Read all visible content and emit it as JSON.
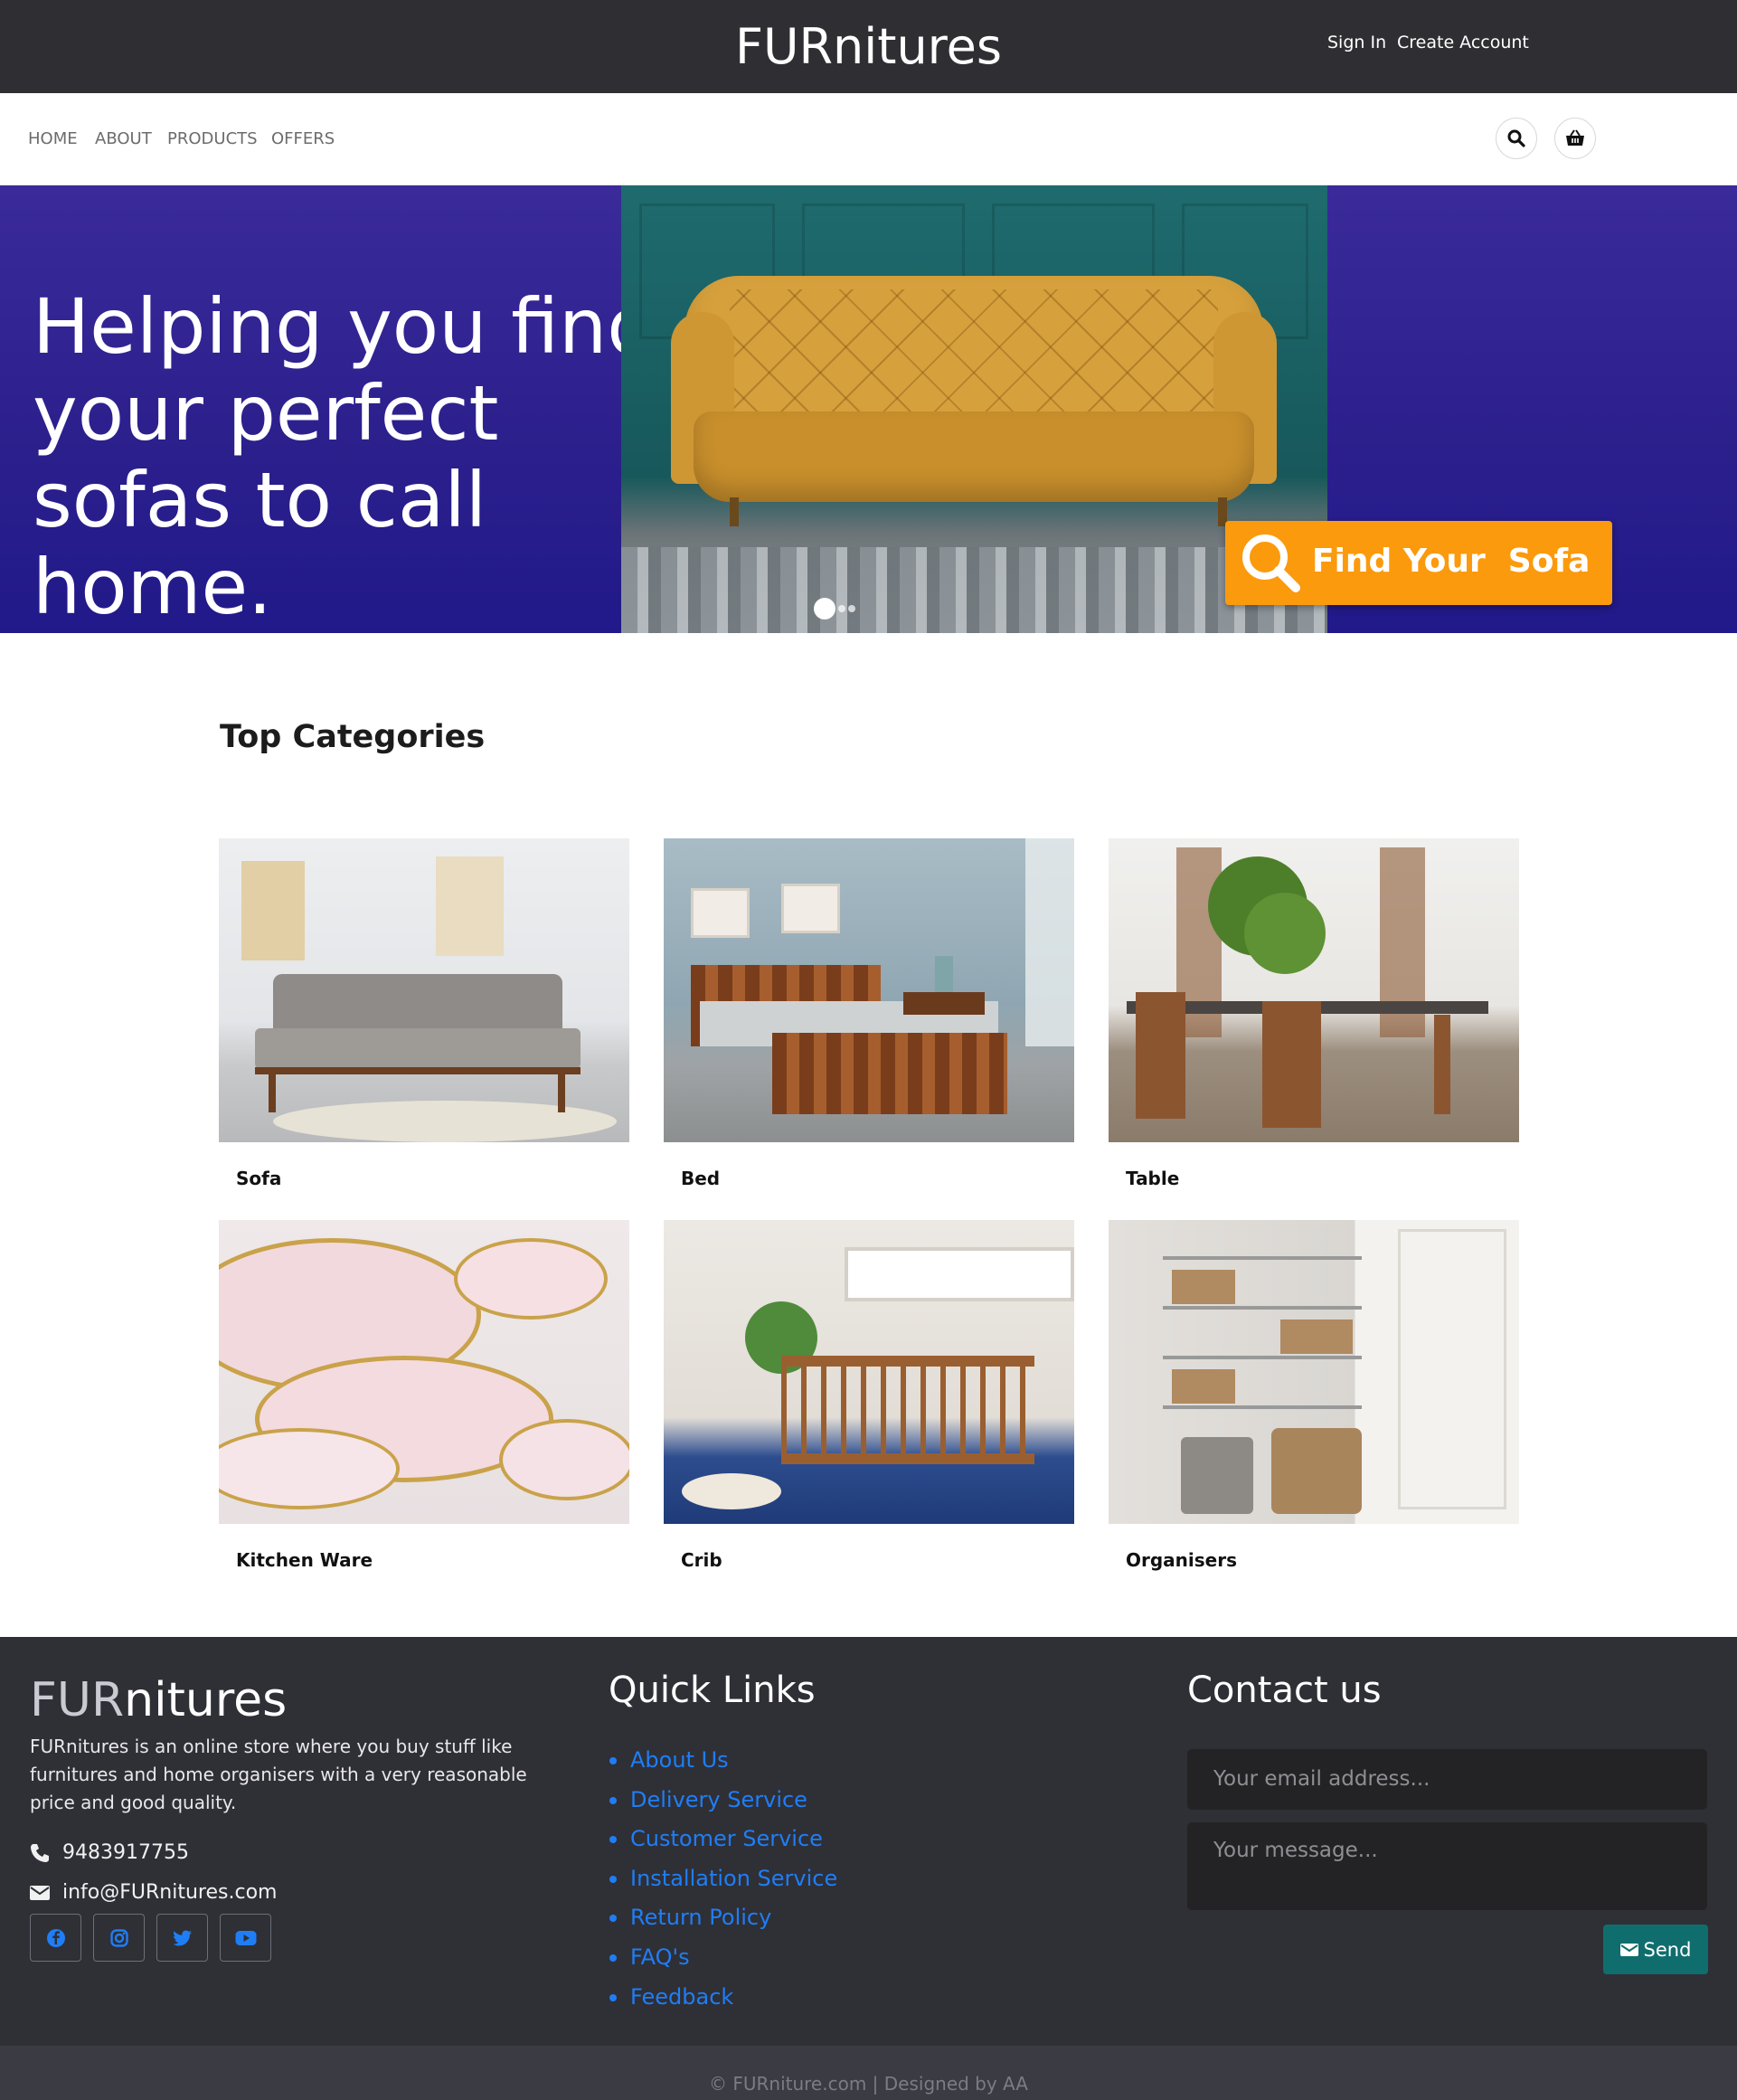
{
  "header": {
    "brand": "FURnitures",
    "sign_in": "Sign In",
    "create_account": "Create Account"
  },
  "nav": {
    "items": [
      "HOME",
      "ABOUT",
      "PRODUCTS",
      "OFFERS"
    ],
    "search_icon": "search-icon",
    "cart_icon": "basket-icon"
  },
  "hero": {
    "title": "Helping you find your perfect sofas to call home.",
    "cta_label": "Find Your  Sofa",
    "carousel_slides": 3,
    "active_slide": 1,
    "colors": {
      "background": "#2b1f8c",
      "cta": "#fb9a0d"
    }
  },
  "categories": {
    "title": "Top Categories",
    "items": [
      "Sofa",
      "Bed",
      "Table",
      "Kitchen Ware",
      "Crib",
      "Organisers"
    ]
  },
  "footer": {
    "brand_main": "FUR",
    "brand_rest": "nitures",
    "description": "FURnitures is an online store where you buy stuff like furnitures and home organisers with a very reasonable price and good quality.",
    "phone": "9483917755",
    "email": "info@FURnitures.com",
    "social_icons": [
      "facebook-icon",
      "instagram-icon",
      "twitter-icon",
      "youtube-icon"
    ],
    "quick_links_title": "Quick Links",
    "quick_links": [
      "About Us",
      "Delivery Service",
      "Customer Service",
      "Installation Service",
      "Return Policy",
      "FAQ's",
      "Feedback"
    ],
    "contact_title": "Contact us",
    "email_placeholder": "Your email address...",
    "message_placeholder": "Your message...",
    "send_label": "Send",
    "copyright": "© FURniture.com | Designed by AA",
    "colors": {
      "link": "#1f7ef5",
      "send": "#0f6e6d",
      "background": "#2f2f36"
    }
  }
}
